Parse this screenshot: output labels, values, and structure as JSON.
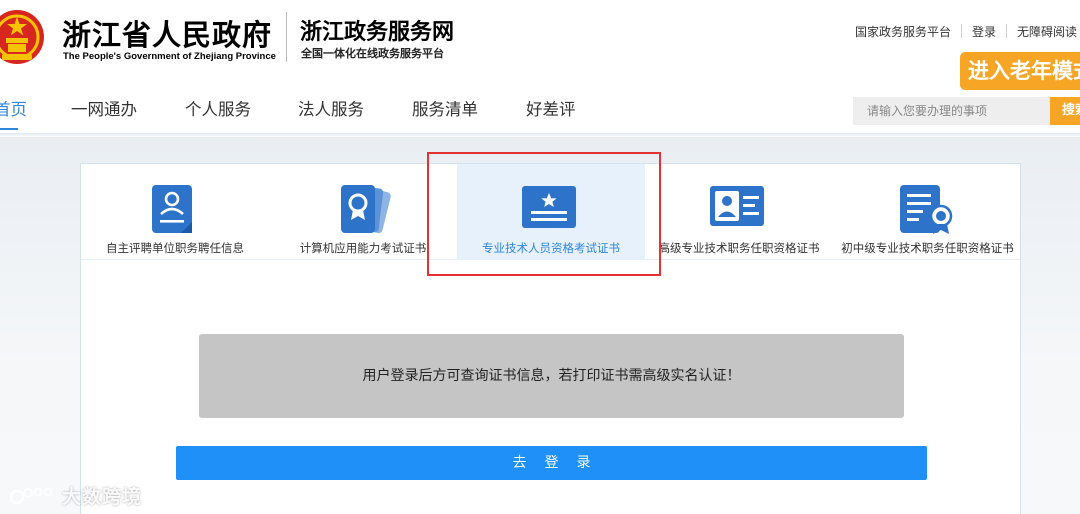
{
  "header": {
    "gov_title": "浙江省人民政府",
    "gov_subtitle": "The People's Government of Zhejiang Province",
    "service_title": "浙江政务服务网",
    "service_subtitle": "全国一体化在线政务服务平台",
    "top_links": [
      "国家政务服务平台",
      "登录",
      "无障碍阅读"
    ],
    "elder_mode_button": "进入老年模式",
    "search_placeholder": "请输入您要办理的事项",
    "search_button": "搜索"
  },
  "nav": {
    "items": [
      "首页",
      "一网通办",
      "个人服务",
      "法人服务",
      "服务清单",
      "好差评"
    ],
    "active_index": 0
  },
  "cert_tabs": {
    "items": [
      {
        "label": "自主评聘单位职务聘任信息",
        "icon": "person-document-icon"
      },
      {
        "label": "计算机应用能力考试证书",
        "icon": "certificate-cards-icon"
      },
      {
        "label": "专业技术人员资格考试证书",
        "icon": "star-card-icon"
      },
      {
        "label": "高级专业技术职务任职资格证书",
        "icon": "id-card-icon"
      },
      {
        "label": "初中级专业技术职务任职资格证书",
        "icon": "document-badge-icon"
      }
    ],
    "active_index": 2
  },
  "notice": "用户登录后方可查询证书信息，若打印证书需高级实名认证！",
  "login_button": "去登录",
  "watermark": "大数跨境",
  "colors": {
    "accent_blue": "#2e86de",
    "button_blue": "#1e90f7",
    "orange": "#f7a524",
    "highlight_red": "#e23232"
  }
}
